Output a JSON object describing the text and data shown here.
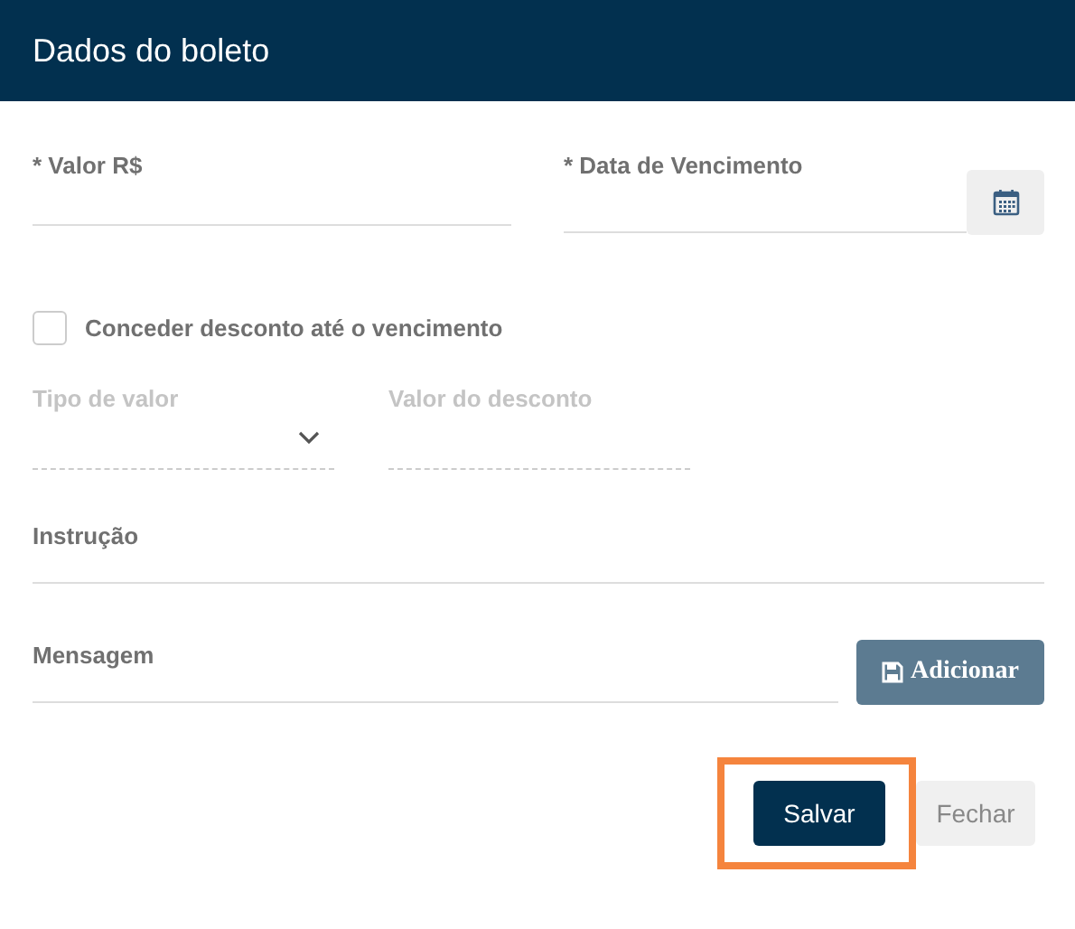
{
  "header": {
    "title": "Dados do boleto"
  },
  "fields_top": [
    {
      "label": "* Valor R$",
      "kind": "text"
    },
    {
      "label": "* Data de Vencimento",
      "kind": "date"
    }
  ],
  "discount": {
    "label": "Conceder desconto até o vencimento",
    "checked": false
  },
  "discount_fields": [
    {
      "label": "Tipo de valor",
      "kind": "select",
      "disabled": true
    },
    {
      "label": "Valor do desconto",
      "kind": "text",
      "disabled": true
    }
  ],
  "instruction": {
    "label": "Instrução"
  },
  "message": {
    "label": "Mensagem",
    "button": "Adicionar"
  },
  "buttons": [
    {
      "label": "Salvar",
      "kind": "primary",
      "highlighted": true
    },
    {
      "label": "Fechar",
      "kind": "secondary",
      "highlighted": false
    }
  ]
}
